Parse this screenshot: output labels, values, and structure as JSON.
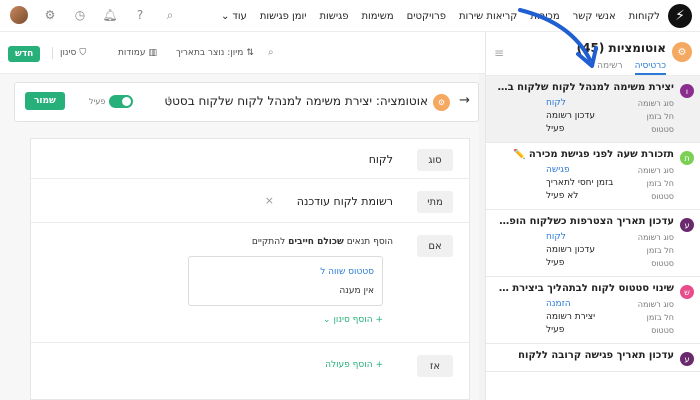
{
  "nav": {
    "links": [
      "לקוחות",
      "אנשי קשר",
      "מכירות",
      "קריאות שירות",
      "פרויקטים",
      "משימות",
      "פגישות",
      "יומן פגישות"
    ],
    "more_label": "עוד"
  },
  "sidebar": {
    "title": "אוטומציות (45)",
    "tabs": [
      "כרטיסיה",
      "רשימה"
    ],
    "active_tab": "כרטיסיה",
    "cards": [
      {
        "icon": "ו",
        "color": "#8b2d8f",
        "title": "יצירת משימה למנהל לקוח שלקוח בסטט...",
        "rows": [
          [
            "סוג רשומה",
            "לקוח",
            true
          ],
          [
            "חל בזמן",
            "עדכון רשומה",
            false
          ],
          [
            "סטטוס",
            "פעיל",
            false
          ]
        ]
      },
      {
        "icon": "ת",
        "color": "#7ccf55",
        "title": "תזכורת שעה לפני פגישת מכירה ✏️",
        "rows": [
          [
            "סוג רשומה",
            "פגישה",
            true
          ],
          [
            "חל בזמן",
            "בזמן יחסי לתאריך",
            false
          ],
          [
            "סטטוס",
            "לא פעיל",
            false
          ]
        ]
      },
      {
        "icon": "ע",
        "color": "#6a2a6e",
        "title": "עדכון תאריך הצטרפות כשלקוח הופך לפ...",
        "rows": [
          [
            "סוג רשומה",
            "לקוח",
            true
          ],
          [
            "חל בזמן",
            "עדכון רשומה",
            false
          ],
          [
            "סטטוס",
            "פעיל",
            false
          ]
        ]
      },
      {
        "icon": "ש",
        "color": "#e84c8a",
        "title": "שינוי סטטוס לקוח לבתהליך ביצירת הזמנ...",
        "rows": [
          [
            "סוג רשומה",
            "הזמנה",
            true
          ],
          [
            "חל בזמן",
            "יצירת רשומה",
            false
          ],
          [
            "סטטוס",
            "פעיל",
            false
          ]
        ]
      },
      {
        "icon": "ע",
        "color": "#6a2a6e",
        "title": "עדכון תאריך פגישה קרובה ללקוח",
        "rows": []
      }
    ]
  },
  "toolbar": {
    "new_label": "חדש",
    "filter_label": "סינון",
    "columns_label": "עמודות",
    "sort_label": "מיון: נוצר בתאריך"
  },
  "detail": {
    "title": "אוטומציה: יצירת משימה למנהל לקוח שלקוח בסטט",
    "active_label": "פעיל",
    "save_label": "שמור",
    "type_pill": "סוג",
    "type_value": "לקוח",
    "when_pill": "מתי",
    "when_value": "רשומת לקוח עודכנה",
    "if_pill": "אם",
    "conditions_hint_pre": "הוסף תנאים ",
    "conditions_hint_bold": "שכולם חייבים",
    "conditions_hint_post": " להתקיים",
    "condition_line1": "סטטוס שווה ל",
    "condition_line2": "אין מענה",
    "add_filter": "הוסף סינון",
    "then_pill": "אז",
    "add_action": "הוסף פעולה"
  },
  "icons": {
    "search": "search-icon",
    "clock": "clock-icon",
    "bell": "bell-icon",
    "help": "help-icon",
    "settings": "gear-icon"
  }
}
